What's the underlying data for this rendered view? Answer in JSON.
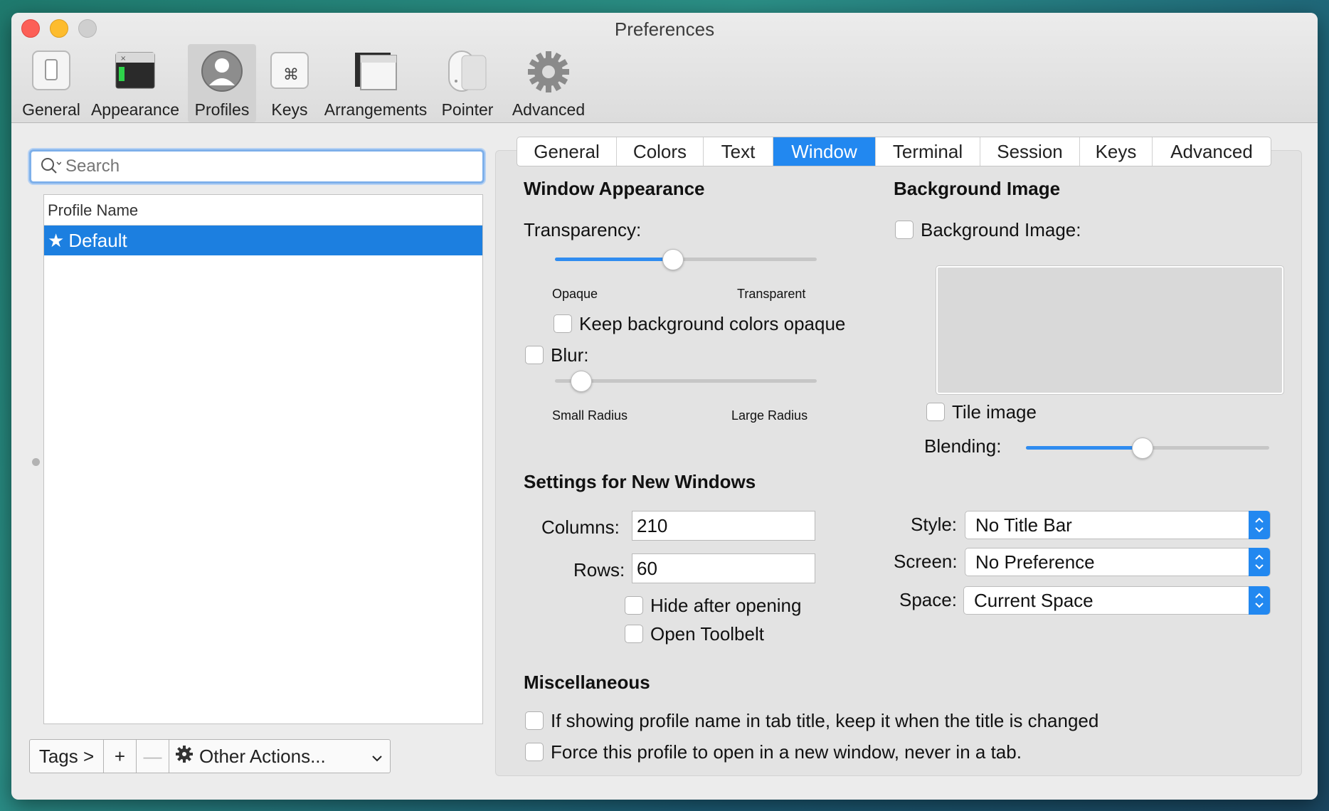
{
  "window": {
    "title": "Preferences"
  },
  "toolbar": {
    "items": [
      {
        "label": "General",
        "icon": "switch-icon"
      },
      {
        "label": "Appearance",
        "icon": "terminal-appearance-icon"
      },
      {
        "label": "Profiles",
        "icon": "profile-avatar-icon",
        "active": true
      },
      {
        "label": "Keys",
        "icon": "command-key-icon"
      },
      {
        "label": "Arrangements",
        "icon": "window-arrangement-icon"
      },
      {
        "label": "Pointer",
        "icon": "mouse-icon"
      },
      {
        "label": "Advanced",
        "icon": "gear-icon"
      }
    ]
  },
  "search": {
    "placeholder": "Search",
    "value": ""
  },
  "profiles": {
    "header": "Profile Name",
    "rows": [
      {
        "star": "★",
        "name": "Default",
        "selected": true
      }
    ]
  },
  "bottom_bar": {
    "tags": "Tags >",
    "add": "+",
    "remove": "—",
    "other_actions": "Other Actions..."
  },
  "tabs": {
    "items": [
      "General",
      "Colors",
      "Text",
      "Window",
      "Terminal",
      "Session",
      "Keys",
      "Advanced"
    ],
    "active": "Window"
  },
  "window_appearance": {
    "heading": "Window Appearance",
    "transparency_label": "Transparency:",
    "transparency_value": 0.45,
    "transparency_min": "Opaque",
    "transparency_max": "Transparent",
    "keep_bg_opaque": "Keep background colors opaque",
    "keep_bg_opaque_checked": false,
    "blur_label": "Blur:",
    "blur_checked": false,
    "blur_value": 0.1,
    "blur_min": "Small Radius",
    "blur_max": "Large Radius"
  },
  "background_image": {
    "heading": "Background Image",
    "checkbox_label": "Background Image:",
    "checked": false,
    "tile_label": "Tile image",
    "tile_checked": false,
    "blending_label": "Blending:",
    "blending_value": 0.48
  },
  "new_windows": {
    "heading": "Settings for New Windows",
    "columns_label": "Columns:",
    "columns_value": "210",
    "rows_label": "Rows:",
    "rows_value": "60",
    "hide_after_opening": "Hide after opening",
    "open_toolbelt": "Open Toolbelt",
    "style_label": "Style:",
    "style_value": "No Title Bar",
    "screen_label": "Screen:",
    "screen_value": "No Preference",
    "space_label": "Space:",
    "space_value": "Current Space"
  },
  "misc": {
    "heading": "Miscellaneous",
    "keep_profile_name": "If showing profile name in tab title, keep it when the title is changed",
    "force_new_window": "Force this profile to open in a new window, never in a tab."
  },
  "colors": {
    "accent": "#2288f0",
    "selection": "#1c7fe0",
    "close": "#fc5f57",
    "minimize": "#fdbc2e"
  }
}
